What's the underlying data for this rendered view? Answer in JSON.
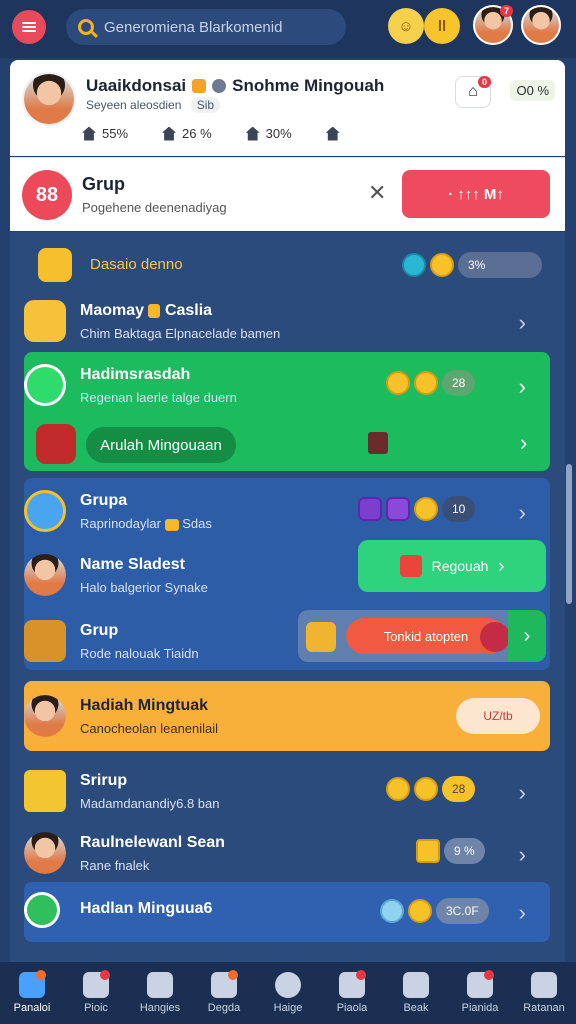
{
  "topbar": {
    "search_placeholder": "Generomiena Blarkomenid",
    "coin_label": "ll",
    "avatar1_badge": "7"
  },
  "profile": {
    "name": "Uaaikdonsai",
    "name2": "Snohme Mingouah",
    "sub": "Seyeen aleosdien",
    "sub_badge": "Sib",
    "stats": [
      "55%",
      "26 %",
      "30%",
      ""
    ],
    "notif_badge": "0",
    "percent": "O0 %"
  },
  "group_card": {
    "logo": "88",
    "title": "Grup",
    "subtitle": "Pogehene deenenadiyag",
    "cta": "· ↑↑↑ M↑"
  },
  "list": {
    "header_title": "Dasaio denno",
    "header_pill": "3%",
    "rows": [
      {
        "title": "Maomay",
        "title2": "Caslia",
        "sub": "Chim Baktaga Elpnacelade bamen"
      },
      {
        "title": "Hadimsrasdah",
        "sub": "Regenan laerle talge duern",
        "pill": "28"
      },
      {
        "button": "Arulah Mingouaan"
      },
      {
        "title": "Grupa",
        "sub": "Raprinodaylar",
        "sub2": "Sdas",
        "pill": "10"
      },
      {
        "title": "Name Sladest",
        "sub": "Halo balgerior Synake",
        "button": "Regouah"
      },
      {
        "title": "Grup",
        "sub": "Rode nalouak",
        "sub2": "Tiaidn",
        "button": "Tonkid atopten"
      },
      {
        "title": "Hadiah Mingtuak",
        "sub": "Canocheolan leanenilail",
        "button": "UZ/tb"
      },
      {
        "title": "Srirup",
        "sub": "Madamdanandiy6.8 ban",
        "pill": "28"
      },
      {
        "title": "Raulnelewanl Sean",
        "sub": "Rane fnalek",
        "pill": "9 %"
      },
      {
        "title": "Hadlan Minguua6",
        "pill": "3C.0F"
      }
    ]
  },
  "nav": [
    {
      "label": "Panaloi",
      "active": true
    },
    {
      "label": "Pioic"
    },
    {
      "label": "Hangies"
    },
    {
      "label": "Degda"
    },
    {
      "label": "Haige"
    },
    {
      "label": "Piaola"
    },
    {
      "label": "Beak"
    },
    {
      "label": "Pianida"
    },
    {
      "label": "Ratanan"
    }
  ]
}
